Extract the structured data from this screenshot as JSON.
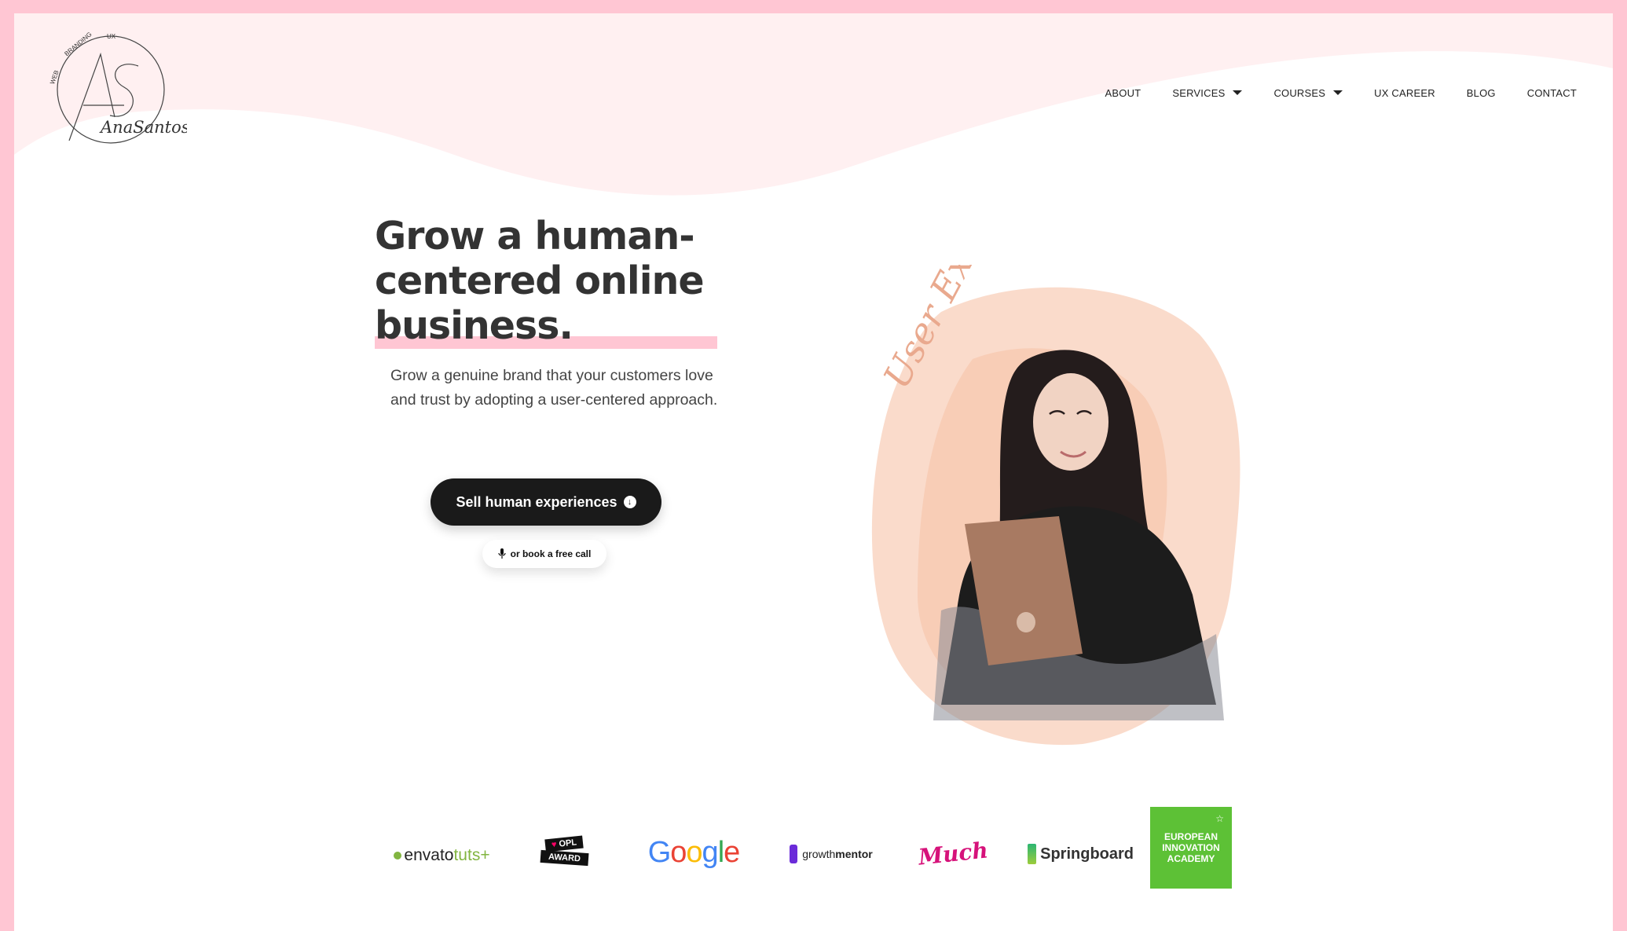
{
  "brand": {
    "name": "AnaSantos",
    "initials": "AS",
    "tagline_parts": [
      "WEB",
      "BRANDING",
      "UX"
    ]
  },
  "nav": {
    "items": [
      {
        "label": "ABOUT"
      },
      {
        "label": "SERVICES",
        "dropdown": true
      },
      {
        "label": "COURSES",
        "dropdown": true
      },
      {
        "label": "UX CAREER"
      },
      {
        "label": "BLOG"
      },
      {
        "label": "CONTACT"
      }
    ]
  },
  "hero": {
    "title": "Grow a human-centered online business.",
    "subtitle": "Grow a genuine brand that your customers love and trust by adopting a user-centered approach.",
    "cta_label": "Sell human experiences",
    "secondary_label": "or book a free call",
    "illustration_text": "User Experience"
  },
  "partners": [
    {
      "name": "envato",
      "suffix": "tuts+",
      "icon": "leaf-icon"
    },
    {
      "name": "OPL",
      "suffix": "AWARD",
      "icon": "heart-icon"
    },
    {
      "name": "Google"
    },
    {
      "name": "growth",
      "suffix": "mentor",
      "icon": "flame-icon"
    },
    {
      "name": "Much"
    },
    {
      "name": "Springboard",
      "icon": "springboard-icon"
    },
    {
      "name": "EUROPEAN INNOVATION ACADEMY",
      "icon": "star-icon"
    }
  ],
  "colors": {
    "accent_pink": "#ffc6d3",
    "wave_pink": "#fff0f1",
    "dark": "#1a1a1a",
    "eia_green": "#5dc136",
    "peach": "#f7c4a8"
  }
}
